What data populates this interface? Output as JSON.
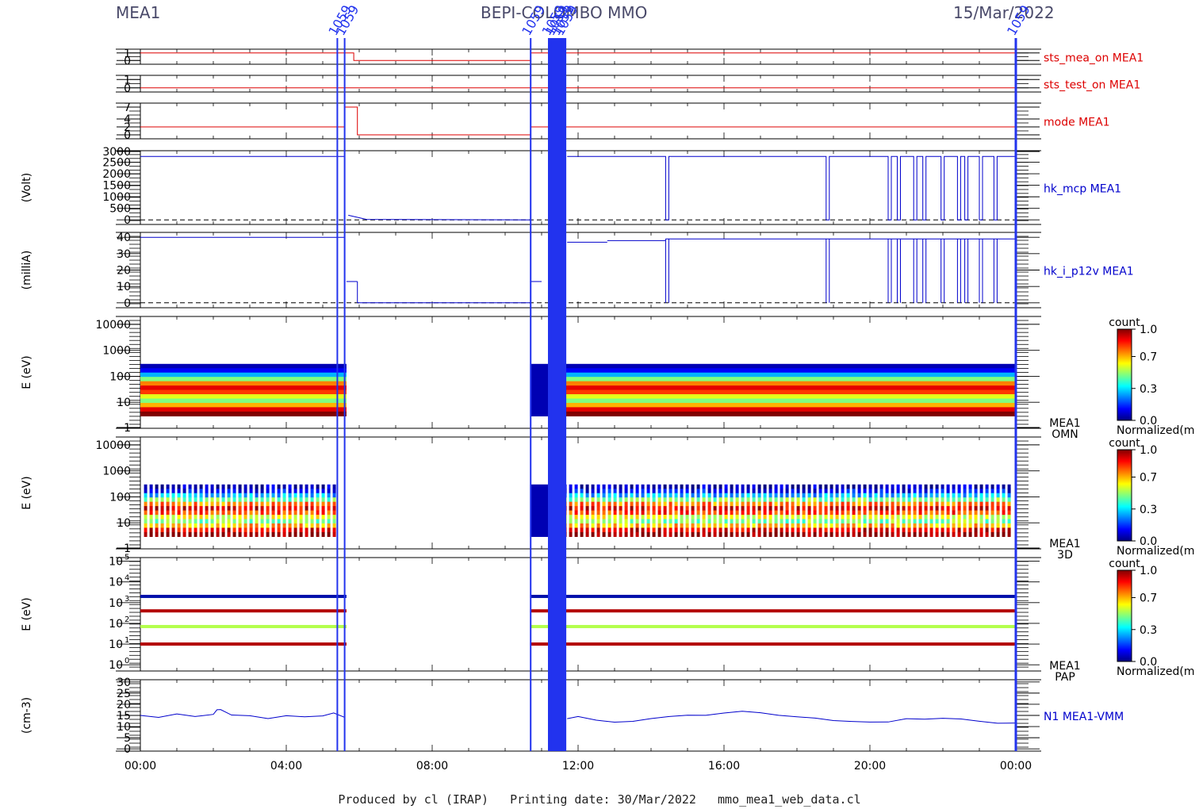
{
  "header": {
    "left": "MEA1",
    "center": "BEPI-COLOMBO MMO",
    "right": "15/Mar/2022"
  },
  "footer": {
    "produced_by": "Produced by cl (IRAP)",
    "printing_date": "Printing date: 30/Mar/2022",
    "file": "mmo_mea1_web_data.cl"
  },
  "colors": {
    "axis": "#000000",
    "red_trace": "#dd0000",
    "blue_trace": "#0000cc",
    "marker": "#2233ee"
  },
  "chart_data": [
    {
      "type": "line",
      "label": "sts_mea_on MEA1",
      "yticks": [
        "1",
        "0"
      ],
      "ylim": [
        -0.5,
        1.5
      ],
      "x_unit": "hours",
      "segments": [
        {
          "x": [
            0,
            5.85
          ],
          "y": 1
        },
        {
          "x": [
            5.85,
            10.7
          ],
          "y": 0
        },
        {
          "x": [
            10.7,
            24
          ],
          "y": 1
        }
      ]
    },
    {
      "type": "line",
      "label": "sts_test_on MEA1",
      "yticks": [
        "1",
        "0"
      ],
      "ylim": [
        -0.5,
        1.5
      ],
      "segments": [
        {
          "x": [
            0,
            24
          ],
          "y": 0
        }
      ]
    },
    {
      "type": "line",
      "label": "mode MEA1",
      "yticks": [
        "7",
        "4",
        "2",
        "0"
      ],
      "ylim": [
        -1,
        8
      ],
      "segments": [
        {
          "x": [
            0,
            5.6
          ],
          "y": 2
        },
        {
          "x": [
            5.6,
            5.95
          ],
          "y": 7
        },
        {
          "x": [
            5.95,
            10.7
          ],
          "y": 0
        },
        {
          "x": [
            10.7,
            24
          ],
          "y": 2
        }
      ]
    },
    {
      "type": "line",
      "label": "hk_mcp MEA1",
      "ylabel": "(Volt)",
      "yticks": [
        "3000",
        "2500",
        "2000",
        "1500",
        "1000",
        "500",
        "0"
      ],
      "ylim": [
        -200,
        3000
      ],
      "baseline": 0,
      "level": 2750,
      "active_intervals": [
        [
          0,
          5.6
        ],
        [
          11.7,
          24
        ]
      ],
      "dropouts": [
        14.4,
        18.8,
        20.5,
        20.75,
        21.2,
        21.45,
        21.95,
        22.4,
        22.6,
        23.0,
        23.4
      ]
    },
    {
      "type": "line",
      "label": "hk_i_p12v MEA1",
      "ylabel": "(milliA)",
      "yticks": [
        "40",
        "30",
        "20",
        "10",
        "0"
      ],
      "ylim": [
        -3,
        43
      ],
      "baseline": 0,
      "segments": [
        {
          "x": [
            0,
            5.6
          ],
          "y": 40
        },
        {
          "x": [
            5.65,
            5.95
          ],
          "y": 13
        },
        {
          "x": [
            5.95,
            10.7
          ],
          "y": 0
        },
        {
          "x": [
            10.7,
            11.0
          ],
          "y": 13
        },
        {
          "x": [
            11.7,
            12.8
          ],
          "y": 37
        },
        {
          "x": [
            12.8,
            14.4
          ],
          "y": 38
        },
        {
          "x": [
            14.4,
            24
          ],
          "y": 39
        }
      ],
      "dropouts": [
        14.4,
        18.8,
        20.5,
        20.75,
        21.2,
        21.45,
        21.95,
        22.4,
        22.6,
        23.0,
        23.4
      ]
    },
    {
      "type": "heatmap",
      "label": "MEA1 OMN",
      "ylabel": "E (eV)",
      "yticks": [
        "10000",
        "1000",
        "100",
        "10",
        "1"
      ],
      "scale": "log",
      "ylim": [
        1,
        20000
      ],
      "energy_range": [
        3,
        300
      ],
      "active_intervals": [
        [
          0,
          5.65
        ],
        [
          10.7,
          11.6
        ],
        [
          11.6,
          24
        ]
      ],
      "colorbar": {
        "title": "count",
        "ticks": [
          "1.0",
          "0.7",
          "0.3",
          "0.0"
        ],
        "label": "Normalized(m"
      }
    },
    {
      "type": "heatmap",
      "label": "MEA1 3D",
      "ylabel": "E (eV)",
      "yticks": [
        "10000",
        "1000",
        "100",
        "10",
        "1"
      ],
      "scale": "log",
      "ylim": [
        1,
        20000
      ],
      "energy_range": [
        3,
        300
      ],
      "striped": true,
      "active_intervals": [
        [
          0.1,
          5.45
        ],
        [
          10.7,
          11.6
        ],
        [
          11.6,
          23.9
        ]
      ],
      "colorbar": {
        "title": "count",
        "ticks": [
          "1.0",
          "0.7",
          "0.3",
          "0.0"
        ],
        "label": "Normalized(m"
      }
    },
    {
      "type": "heatmap",
      "label": "MEA1 PAP",
      "ylabel": "E (eV)",
      "yticks": [
        "10",
        "10",
        "10",
        "10",
        "10",
        "10"
      ],
      "ytick_exponents": [
        "5",
        "4",
        "3",
        "2",
        "1",
        "0"
      ],
      "scale": "log",
      "ylim": [
        0.5,
        150000
      ],
      "bands": [
        2000,
        400,
        70,
        10
      ],
      "active_intervals": [
        [
          0,
          5.65
        ],
        [
          10.7,
          24
        ]
      ],
      "colorbar": {
        "title": "count",
        "ticks": [
          "1.0",
          "0.7",
          "0.3",
          "0.0"
        ],
        "label": "Normalized(m"
      }
    },
    {
      "type": "line",
      "label": "N1 MEA1-VMM",
      "ylabel": "(cm-3)",
      "yticks": [
        "30",
        "25",
        "20",
        "15",
        "10",
        "5",
        "0"
      ],
      "ylim": [
        -1,
        31
      ],
      "x": [
        0,
        0.5,
        1,
        1.5,
        2,
        2.1,
        2.2,
        2.5,
        3,
        3.5,
        4,
        4.5,
        5,
        5.3,
        5.6,
        11.7,
        12,
        12.5,
        13,
        13.5,
        14,
        14.5,
        15,
        15.5,
        16,
        16.5,
        17,
        17.5,
        18,
        18.5,
        19,
        19.5,
        20,
        20.5,
        21,
        21.5,
        22,
        22.5,
        23,
        23.5,
        24
      ],
      "y": [
        15,
        14,
        15,
        14.5,
        15,
        18,
        17,
        14.5,
        15,
        14,
        15,
        15,
        14.5,
        16,
        14,
        13,
        14,
        13,
        12.5,
        12,
        13,
        14,
        15,
        15,
        16,
        16.5,
        16,
        15,
        14,
        13.5,
        13,
        13,
        12.5,
        12.5,
        13,
        13.5,
        13.5,
        13,
        12,
        12,
        12
      ]
    }
  ],
  "xaxis": {
    "ticks": [
      "00:00",
      "04:00",
      "08:00",
      "12:00",
      "16:00",
      "20:00",
      "00:00"
    ],
    "range_hours": [
      0,
      24
    ]
  },
  "marker_lines": [
    5.4,
    5.6,
    10.7,
    11.25,
    11.35,
    11.5,
    11.6,
    24
  ]
}
